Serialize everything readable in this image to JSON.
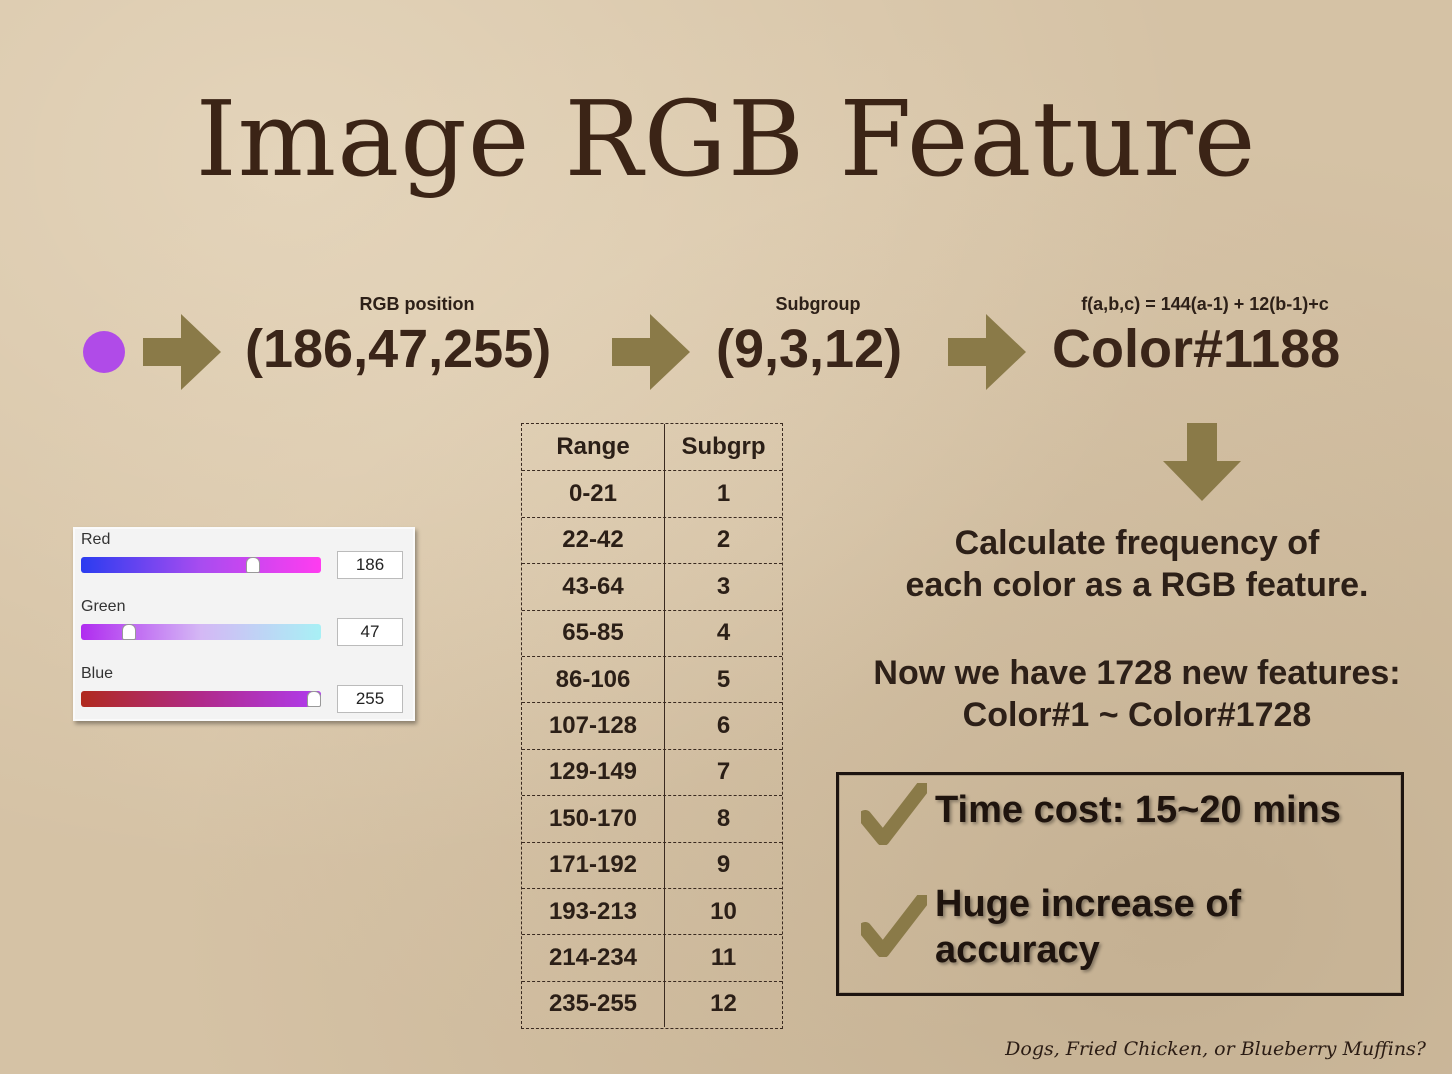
{
  "title": "Image RGB Feature",
  "labels": {
    "rgb_position": "RGB position",
    "subgroup": "Subgroup",
    "formula": "f(a,b,c) = 144(a-1) + 12(b-1)+c"
  },
  "values": {
    "rgb": "(186,47,255)",
    "subgroup": "(9,3,12)",
    "color": "Color#1188"
  },
  "colors": {
    "swatch": "#b04be8",
    "arrow": "#8a7a48"
  },
  "table": {
    "headers": [
      "Range",
      "Subgrp"
    ],
    "rows": [
      [
        "0-21",
        "1"
      ],
      [
        "22-42",
        "2"
      ],
      [
        "43-64",
        "3"
      ],
      [
        "65-85",
        "4"
      ],
      [
        "86-106",
        "5"
      ],
      [
        "107-128",
        "6"
      ],
      [
        "129-149",
        "7"
      ],
      [
        "150-170",
        "8"
      ],
      [
        "171-192",
        "9"
      ],
      [
        "193-213",
        "10"
      ],
      [
        "214-234",
        "11"
      ],
      [
        "235-255",
        "12"
      ]
    ]
  },
  "sliders": [
    {
      "label": "Red",
      "value": "186",
      "fraction": 0.73
    },
    {
      "label": "Green",
      "value": "47",
      "fraction": 0.18
    },
    {
      "label": "Blue",
      "value": "255",
      "fraction": 1.0
    }
  ],
  "calc_text": [
    "Calculate frequency of",
    "each color as a RGB feature."
  ],
  "features_text": [
    "Now we have 1728 new features:",
    "Color#1 ~ Color#1728"
  ],
  "box": {
    "item1": "Time cost: 15~20 mins",
    "item2_line1": "Huge increase of",
    "item2_line2": "accuracy"
  },
  "footer": "Dogs, Fried Chicken, or Blueberry Muffins?"
}
